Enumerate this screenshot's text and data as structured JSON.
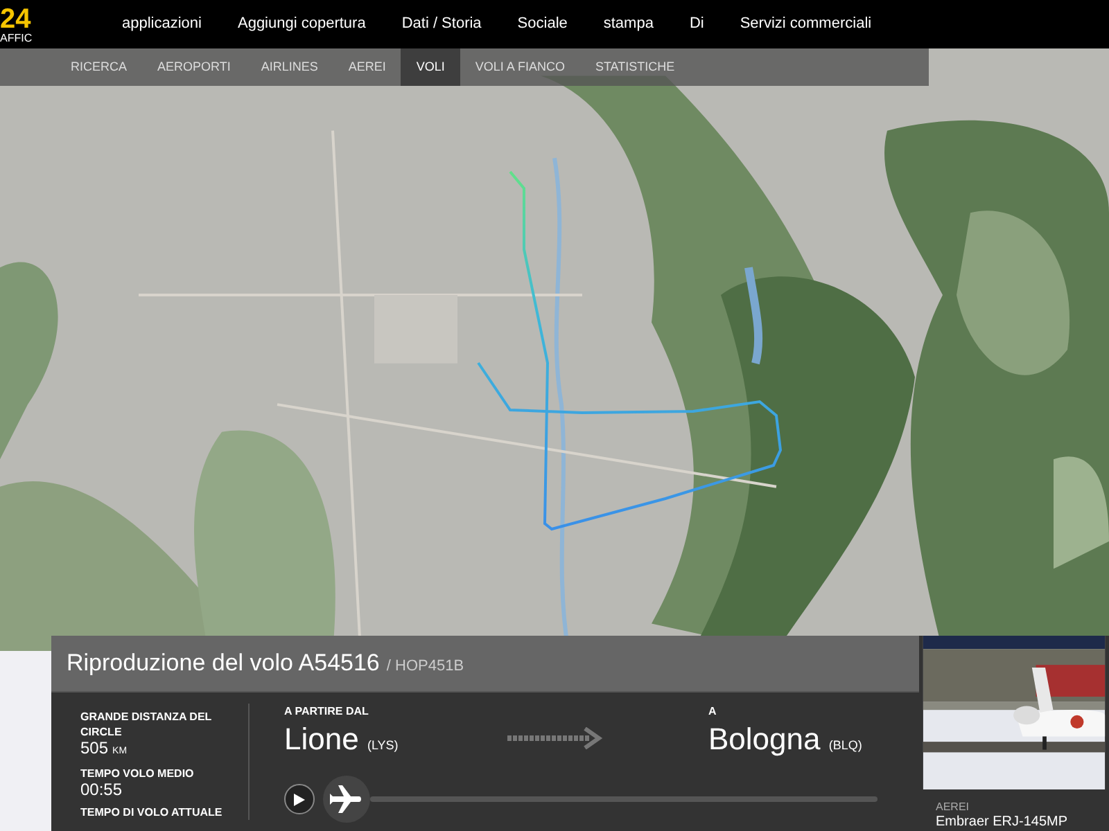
{
  "logo": {
    "number": "24",
    "tagline": "AFFIC"
  },
  "nav": [
    "applicazioni",
    "Aggiungi copertura",
    "Dati / Storia",
    "Sociale",
    "stampa",
    "Di",
    "Servizi commerciali"
  ],
  "subnav": [
    {
      "label": "RICERCA",
      "selected": false
    },
    {
      "label": "AEROPORTI",
      "selected": false
    },
    {
      "label": "AIRLINES",
      "selected": false
    },
    {
      "label": "AEREI",
      "selected": false
    },
    {
      "label": "VOLI",
      "selected": true
    },
    {
      "label": "VOLI A FIANCO",
      "selected": false
    },
    {
      "label": "STATISTICHE",
      "selected": false
    }
  ],
  "replay": {
    "title": "Riproduzione del volo A54516",
    "callsign": "/ HOP451B",
    "stats": [
      {
        "label": "GRANDE DISTANZA DEL CIRCLE",
        "value": "505",
        "unit": "KM"
      },
      {
        "label": "TEMPO VOLO MEDIO",
        "value": "00:55"
      },
      {
        "label": "TEMPO DI VOLO ATTUALE"
      }
    ],
    "departure": {
      "label": "A PARTIRE DAL",
      "city": "Lione",
      "code": "(LYS)"
    },
    "arrival": {
      "label": "A",
      "city": "Bologna",
      "code": "(BLQ)"
    },
    "playback": {
      "playing": false
    },
    "aircraft": {
      "label": "AEREI",
      "model": "Embraer ERJ-145MP"
    }
  }
}
